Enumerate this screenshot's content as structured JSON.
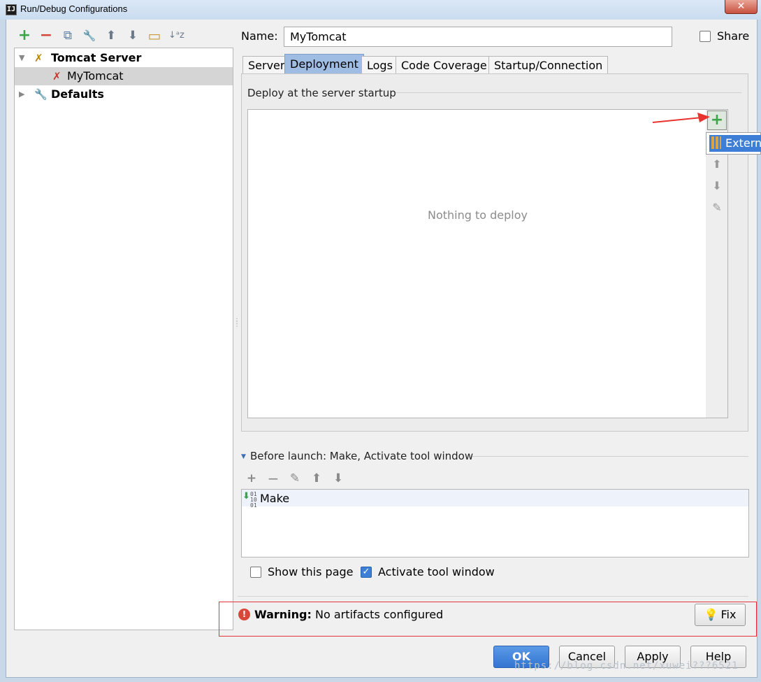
{
  "window": {
    "title": "Run/Debug Configurations",
    "app_icon_text": "IJ",
    "close_glyph": "✕"
  },
  "left_toolbar": {
    "add_glyph": "+",
    "remove_glyph": "−",
    "copy_glyph": "⧉",
    "edit_defaults_glyph": "🔧",
    "move_up_glyph": "⬆",
    "move_down_glyph": "⬇",
    "folder_glyph": "▭",
    "sort_glyph": "↓ᵃz"
  },
  "tree": {
    "items": [
      {
        "label": "Tomcat Server",
        "expanded": true
      },
      {
        "label": "MyTomcat",
        "selected": true
      },
      {
        "label": "Defaults",
        "expanded": false
      }
    ]
  },
  "config": {
    "name_label": "Name:",
    "name_value": "MyTomcat",
    "share_label": "Share",
    "share_checked": false
  },
  "tabs": [
    {
      "label": "Server",
      "active": false
    },
    {
      "label": "Deployment",
      "active": true
    },
    {
      "label": "Logs",
      "active": false
    },
    {
      "label": "Code Coverage",
      "active": false
    },
    {
      "label": "Startup/Connection",
      "active": false
    }
  ],
  "deployment": {
    "section_label": "Deploy at the server startup",
    "empty_text": "Nothing to deploy",
    "add_glyph": "+",
    "popup_item_label": "Extern"
  },
  "before_launch": {
    "label": "Before launch: Make, Activate tool window",
    "tasks": [
      {
        "label": "Make"
      }
    ]
  },
  "options": {
    "show_this_page_label": "Show this page",
    "show_this_page_checked": false,
    "activate_tool_window_label": "Activate tool window",
    "activate_tool_window_checked": true
  },
  "warning": {
    "bold_text": "Warning:",
    "text": "No artifacts configured",
    "fix_label": "Fix",
    "icon_glyph": "!"
  },
  "buttons": {
    "ok": "OK",
    "cancel": "Cancel",
    "apply": "Apply",
    "help": "Help"
  },
  "watermark": "https://blog.csdn.net/xuwei???6521",
  "colors": {
    "accent": "#3d7fd6",
    "warning_frame": "#e0333a",
    "add_green": "#3aa549",
    "remove_red": "#d8463a"
  }
}
